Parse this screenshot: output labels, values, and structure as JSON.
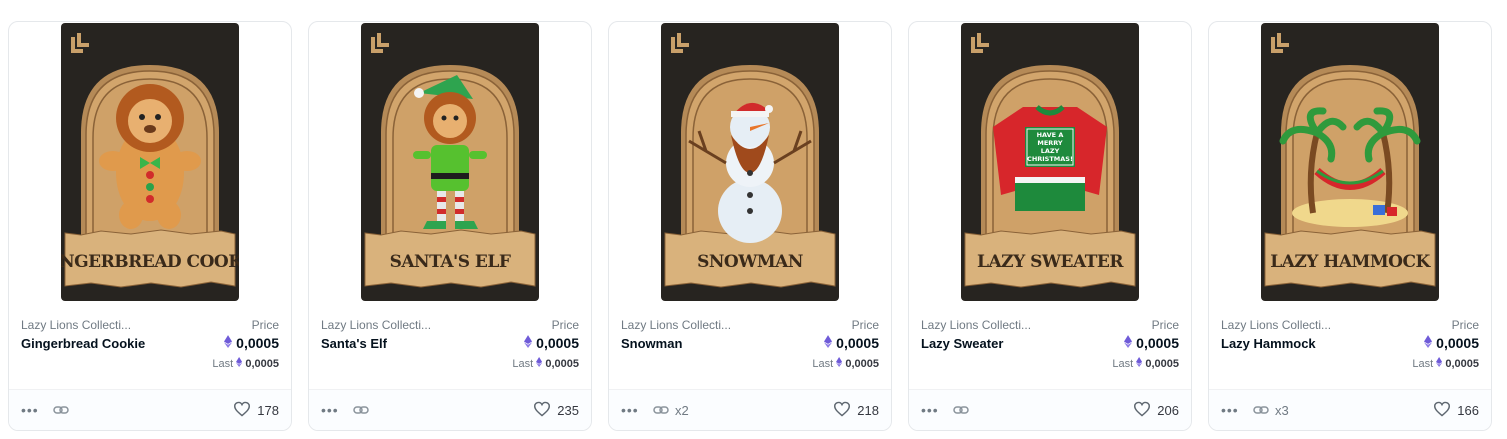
{
  "colors": {
    "accent_eth": "#6f5bd8",
    "card_border": "#e5e8eb",
    "art_bg": "#272420",
    "frame_tan": "#c9a06a",
    "muted_text": "#707a83"
  },
  "labels": {
    "price": "Price",
    "last": "Last"
  },
  "cards": [
    {
      "collection": "Lazy Lions Collecti...",
      "name": "Gingerbread Cookie",
      "art_title": "GINGERBREAD COOKIE",
      "art_icon": "gingerbread-lion-icon",
      "price": "0,0005",
      "last_price": "0,0005",
      "copies": "",
      "likes": "178"
    },
    {
      "collection": "Lazy Lions Collecti...",
      "name": "Santa's Elf",
      "art_title": "SANTA'S ELF",
      "art_icon": "elf-lion-icon",
      "price": "0,0005",
      "last_price": "0,0005",
      "copies": "",
      "likes": "235"
    },
    {
      "collection": "Lazy Lions Collecti...",
      "name": "Snowman",
      "art_title": "SNOWMAN",
      "art_icon": "snowman-icon",
      "price": "0,0005",
      "last_price": "0,0005",
      "copies": "x2",
      "likes": "218"
    },
    {
      "collection": "Lazy Lions Collecti...",
      "name": "Lazy Sweater",
      "art_title": "LAZY SWEATER",
      "art_icon": "sweater-icon",
      "sweater_text": "HAVE A MERRY LAZY CHRISTMAS!",
      "price": "0,0005",
      "last_price": "0,0005",
      "copies": "",
      "likes": "206"
    },
    {
      "collection": "Lazy Lions Collecti...",
      "name": "Lazy Hammock",
      "art_title": "LAZY HAMMOCK",
      "art_icon": "hammock-icon",
      "price": "0,0005",
      "last_price": "0,0005",
      "copies": "x3",
      "likes": "166"
    }
  ]
}
